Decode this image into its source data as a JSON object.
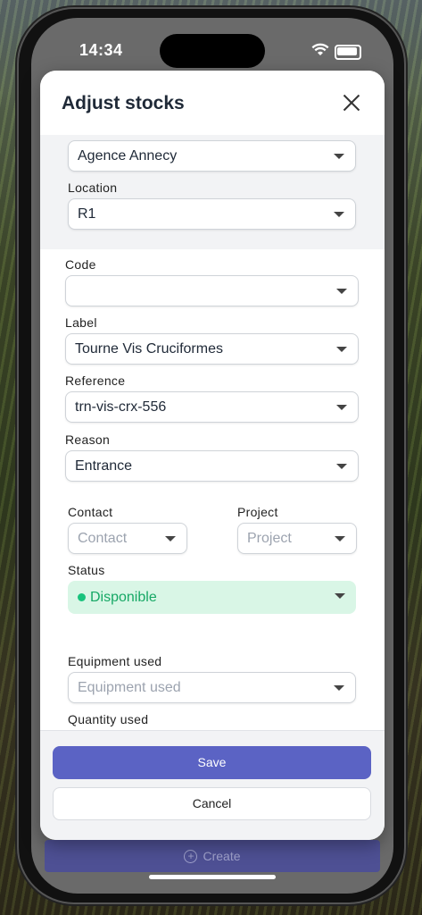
{
  "status_bar": {
    "time": "14:34"
  },
  "modal": {
    "title": "Adjust stocks",
    "agency_value": "Agence Annecy",
    "location": {
      "label": "Location",
      "value": "R1"
    },
    "code": {
      "label": "Code",
      "value": ""
    },
    "label_field": {
      "label": "Label",
      "value": "Tourne Vis Cruciformes"
    },
    "reference": {
      "label": "Reference",
      "value": "trn-vis-crx-556"
    },
    "reason": {
      "label": "Reason",
      "value": "Entrance"
    },
    "contact": {
      "label": "Contact",
      "placeholder": "Contact"
    },
    "project": {
      "label": "Project",
      "placeholder": "Project"
    },
    "status": {
      "label": "Status",
      "value": "Disponible",
      "color": "#19c37d"
    },
    "equipment": {
      "label": "Equipment used",
      "placeholder": "Equipment used"
    },
    "quantity": {
      "label": "Quantity used"
    },
    "save_label": "Save",
    "cancel_label": "Cancel"
  },
  "backdrop": {
    "create_label": "Create"
  },
  "colors": {
    "accent": "#5b63c4",
    "status_bg": "#d9f6e6"
  }
}
